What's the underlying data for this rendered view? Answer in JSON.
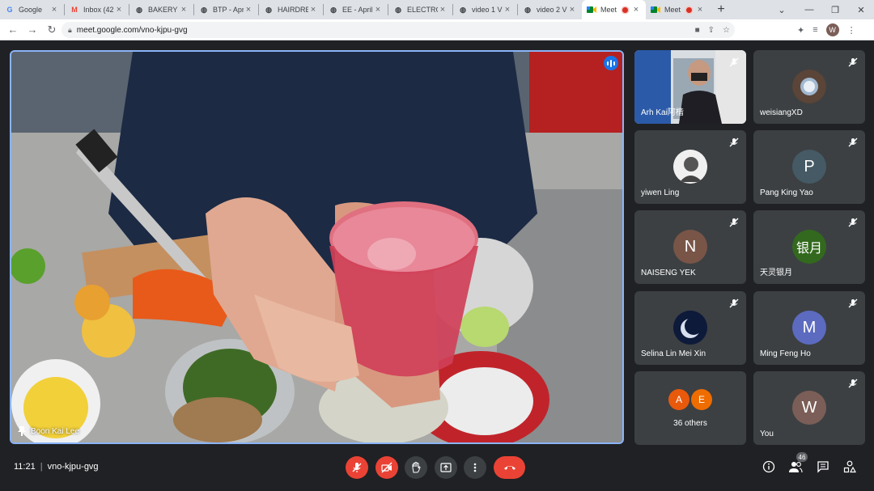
{
  "browser": {
    "tabs": [
      {
        "title": "Google",
        "icon": "google-icon"
      },
      {
        "title": "Inbox (42",
        "icon": "gmail-icon"
      },
      {
        "title": "BAKERY 2",
        "icon": "globe-icon"
      },
      {
        "title": "BTP - Apr",
        "icon": "globe-icon"
      },
      {
        "title": "HAIRDRE",
        "icon": "globe-icon"
      },
      {
        "title": "EE - April",
        "icon": "globe-icon"
      },
      {
        "title": "ELECTRO",
        "icon": "globe-icon"
      },
      {
        "title": "video 1 V",
        "icon": "globe-icon"
      },
      {
        "title": "video 2 V",
        "icon": "globe-icon"
      },
      {
        "title": "Meet",
        "icon": "meet-icon",
        "recording": true,
        "active": true
      },
      {
        "title": "Meet",
        "icon": "meet-icon",
        "recording": true
      }
    ],
    "url": "meet.google.com/vno-kjpu-gvg",
    "profile_initial": "W"
  },
  "meeting": {
    "main_speaker": "Boon Kai Lee",
    "time": "11:21",
    "code": "vno-kjpu-gvg",
    "participant_count": "46"
  },
  "participants": [
    {
      "name": "Arh Kai阿楷",
      "avatar": "video",
      "muted": true
    },
    {
      "name": "weisiangXD",
      "avatar": "photo",
      "muted": true
    },
    {
      "name": "yiwen Ling",
      "avatar": "photo",
      "muted": true
    },
    {
      "name": "Pang King Yao",
      "initial": "P",
      "color": "#455a64",
      "muted": true
    },
    {
      "name": "NAISENG YEK",
      "initial": "N",
      "color": "#795548",
      "muted": true
    },
    {
      "name": "天灵银月",
      "initial": "银月",
      "color": "#33691e",
      "muted": true
    },
    {
      "name": "Selina Lin Mei Xin",
      "avatar": "photo",
      "muted": true
    },
    {
      "name": "Ming Feng Ho",
      "initial": "M",
      "color": "#5c6bc0",
      "muted": true
    },
    {
      "name": "You",
      "initial": "W",
      "color": "#7b5e57",
      "muted": true
    }
  ],
  "others": {
    "label": "36 others",
    "initials": [
      "A",
      "E"
    ],
    "colors": [
      "#e8590c",
      "#ef6c00"
    ]
  },
  "colors": {
    "background": "#202124",
    "tile": "#3c4043",
    "danger": "#ea4335",
    "accent": "#8ab4f8"
  }
}
